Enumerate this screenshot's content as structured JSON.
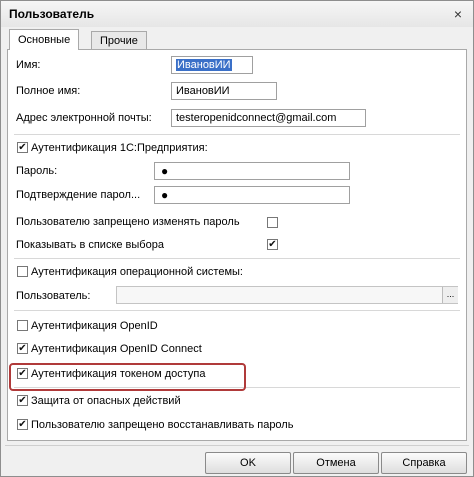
{
  "window": {
    "title": "Пользователь",
    "close_glyph": "×"
  },
  "tabs": [
    {
      "label": "Основные",
      "active": true
    },
    {
      "label": "Прочие",
      "active": false
    }
  ],
  "fields": {
    "name": {
      "label": "Имя:",
      "value": "ИвановИИ"
    },
    "full_name": {
      "label": "Полное имя:",
      "value": "ИвановИИ"
    },
    "email": {
      "label": "Адрес электронной почты:",
      "value": "testeropenidconnect@gmail.com"
    }
  },
  "auth_1c": {
    "label": "Аутентификация 1С:Предприятия:",
    "checked": true,
    "password_label": "Пароль:",
    "password_value": "●",
    "confirm_label": "Подтверждение парол...",
    "confirm_value": "●",
    "no_change_label": "Пользователю запрещено изменять пароль",
    "no_change_checked": false,
    "show_in_list_label": "Показывать в списке выбора",
    "show_in_list_checked": true
  },
  "auth_os": {
    "label": "Аутентификация операционной системы:",
    "checked": false,
    "user_label": "Пользователь:",
    "user_value": "",
    "select_glyph": "..."
  },
  "auth_openid": {
    "label": "Аутентификация OpenID",
    "checked": false
  },
  "auth_openid_connect": {
    "label": "Аутентификация OpenID Connect",
    "checked": true
  },
  "auth_token": {
    "label": "Аутентификация токеном доступа",
    "checked": true
  },
  "protect_dangerous": {
    "label": "Защита от опасных действий",
    "checked": true
  },
  "no_restore_password": {
    "label": "Пользователю запрещено восстанавливать пароль",
    "checked": true
  },
  "buttons": {
    "ok": "OK",
    "cancel": "Отмена",
    "help": "Справка"
  },
  "check_glyph": "✔",
  "colors": {
    "highlight": "#b03a3a",
    "selection": "#3a70c8"
  }
}
